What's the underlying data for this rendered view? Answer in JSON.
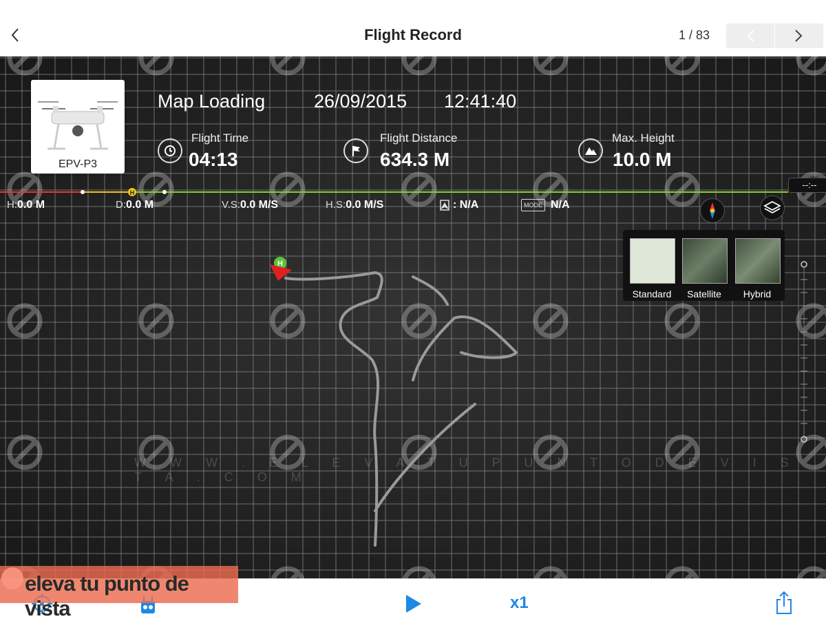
{
  "header": {
    "title": "Flight Record",
    "pager": "1 / 83"
  },
  "aircraft": {
    "model": "EPV-P3"
  },
  "record": {
    "status": "Map Loading",
    "date": "26/09/2015",
    "time": "12:41:40"
  },
  "stats": {
    "flight_time": {
      "label": "Flight Time",
      "value": "04:13"
    },
    "flight_distance": {
      "label": "Flight Distance",
      "value": "634.3 M"
    },
    "max_height": {
      "label": "Max. Height",
      "value": "10.0 M"
    }
  },
  "telemetry": {
    "h_label": "H:",
    "h_value": "0.0 M",
    "d_label": "D:",
    "d_value": "0.0 M",
    "vs_label": "V.S:",
    "vs_value": "0.0 M/S",
    "hs_label": "H.S:",
    "hs_value": "0.0 M/S",
    "gps_value": ": N/A",
    "mode_badge": "MODE",
    "mode_value": "N/A"
  },
  "timeline": {
    "time_display": "--:--",
    "home_marker": "H"
  },
  "map_types": [
    {
      "label": "Standard"
    },
    {
      "label": "Satellite"
    },
    {
      "label": "Hybrid"
    }
  ],
  "map": {
    "home_marker": "H"
  },
  "watermark": {
    "url_text": "W W W . E L E V A T U P U N T O D E V I S T A . C O M",
    "logo_text": "eleva tu punto de vista"
  },
  "playback": {
    "speed": "x1"
  },
  "colors": {
    "accent": "#1e88e5",
    "track_green": "#8bd12a",
    "track_red": "#e53935",
    "track_yellow": "#f5c518"
  }
}
